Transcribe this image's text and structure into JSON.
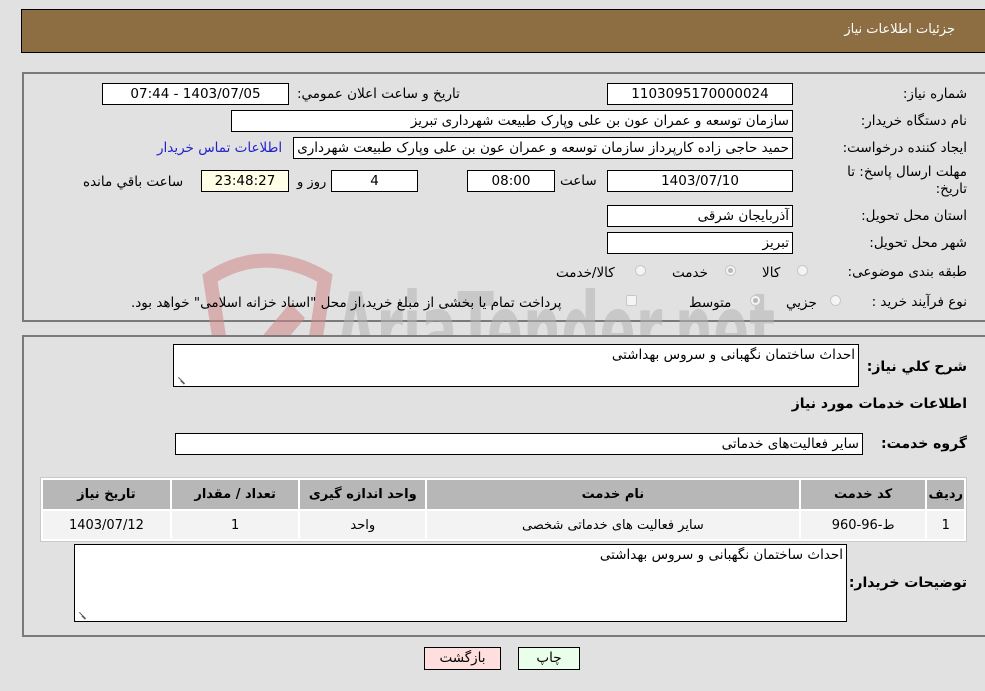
{
  "header": {
    "title": "جزئیات اطلاعات نیاز"
  },
  "fields": {
    "need_number": {
      "label": "شماره نیاز:",
      "value": "1103095170000024"
    },
    "announce_datetime": {
      "label": "تاریخ و ساعت اعلان عمومي:",
      "value": "1403/07/05 - 07:44"
    },
    "buyer_org": {
      "label": "نام دستگاه خریدار:",
      "value": "سازمان توسعه و عمران عون بن علی وپارک طبیعت شهرداری تبریز"
    },
    "requester": {
      "label": "ایجاد کننده درخواست:",
      "value": "حمید حاجی زاده کارپرداز سازمان توسعه و عمران عون بن علی وپارک طبیعت شهرداری تبریز"
    },
    "buyer_contact_link": "اطلاعات تماس خریدار",
    "deadline": {
      "label_line1": "مهلت ارسال پاسخ: تا",
      "label_line2": "تاریخ:",
      "date": "1403/07/10",
      "time_label": "ساعت",
      "time": "08:00",
      "days": "4",
      "days_label": "روز و",
      "remaining": "23:48:27",
      "remaining_label": "ساعت باقي مانده"
    },
    "province": {
      "label": "استان محل تحویل:",
      "value": "آذربایجان شرقی"
    },
    "city": {
      "label": "شهر محل تحویل:",
      "value": "تبریز"
    },
    "category": {
      "label": "طبقه بندی موضوعی:",
      "options": [
        {
          "label": "کالا",
          "checked": false
        },
        {
          "label": "خدمت",
          "checked": true
        },
        {
          "label": "کالا/خدمت",
          "checked": false
        }
      ]
    },
    "purchase_type": {
      "label": "نوع فرآیند خرید :",
      "options": [
        {
          "label": "جزيي",
          "checked": false
        },
        {
          "label": "متوسط",
          "checked": true
        }
      ],
      "checkbox_label": "پرداخت تمام یا بخشی از مبلغ خرید،از محل \"اسناد خزانه اسلامی\" خواهد بود.",
      "checkbox_checked": false
    }
  },
  "description": {
    "label": "شرح کلي نیاز:",
    "value": "احداث ساختمان نگهبانی و سروس بهداشتی"
  },
  "services_heading": "اطلاعات خدمات مورد نیاز",
  "service_group": {
    "label": "گروه خدمت:",
    "value": "سایر فعالیت‌های خدماتی"
  },
  "table": {
    "headers": [
      "ردیف",
      "کد خدمت",
      "نام خدمت",
      "واحد اندازه گیری",
      "تعداد / مقدار",
      "تاریخ نیاز"
    ],
    "rows": [
      [
        "1",
        "ط-96-960",
        "سایر فعالیت های خدماتی شخصی",
        "واحد",
        "1",
        "1403/07/12"
      ]
    ]
  },
  "buyer_notes": {
    "label": "توضیحات خریدار:",
    "value": "احداث ساختمان نگهبانی و سروس بهداشتی"
  },
  "buttons": {
    "print": "چاپ",
    "back": "بازگشت"
  },
  "watermark": {
    "text": "AriaTender.net",
    "colors": {
      "shield": "#d9a6a6",
      "text": "#b4b4b4"
    }
  }
}
